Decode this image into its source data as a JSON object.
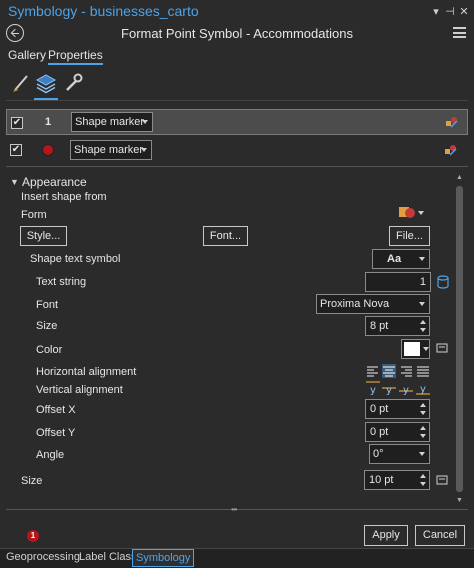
{
  "window": {
    "title": "Symbology - businesses_carto",
    "subtitle": "Format Point Symbol - Accommodations"
  },
  "tabs": {
    "gallery": "Gallery",
    "properties": "Properties"
  },
  "layers": [
    {
      "checked": "✔",
      "index": "1",
      "type": "Shape marker"
    },
    {
      "checked": "✔",
      "type": "Shape marker",
      "color": "#b3161b"
    }
  ],
  "appearance": {
    "header": "Appearance",
    "insert_shape_from": "Insert shape from",
    "form": "Form",
    "style_button": "Style...",
    "font_button": "Font...",
    "file_button": "File...",
    "shape_text_symbol": "Shape text symbol",
    "shape_text_value": "Aa",
    "text_string_label": "Text string",
    "text_string_value": "1",
    "font_label": "Font",
    "font_value": "Proxima Nova",
    "size_label": "Size",
    "size_value": "8 pt",
    "color_label": "Color",
    "color_value": "#ffffff",
    "horizontal_alignment_label": "Horizontal alignment",
    "vertical_alignment_label": "Vertical alignment",
    "offset_x_label": "Offset X",
    "offset_x_value": "0 pt",
    "offset_y_label": "Offset Y",
    "offset_y_value": "0 pt",
    "angle_label": "Angle",
    "angle_value": "0°",
    "outer_size_label": "Size",
    "outer_size_value": "10 pt"
  },
  "footer": {
    "badge": "1",
    "apply": "Apply",
    "cancel": "Cancel"
  },
  "bottom_tabs": [
    "Geoprocessing",
    "Label Class",
    "Symbology"
  ],
  "accent_color": "#4da3e8"
}
